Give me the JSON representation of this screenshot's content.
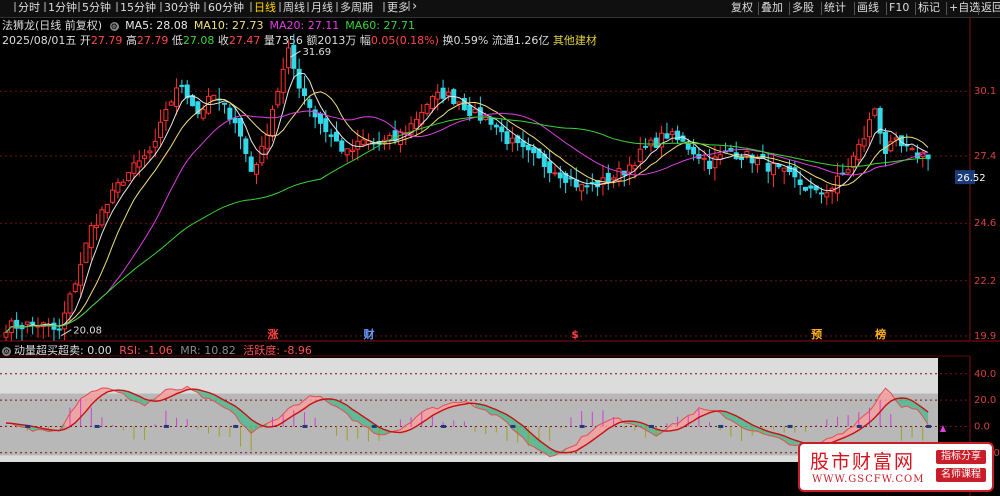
{
  "timeframe_tabs": [
    "分时",
    "1分钟",
    "5分钟",
    "15分钟",
    "30分钟",
    "60分钟",
    "日线",
    "周线",
    "月线",
    "多周期",
    "更多"
  ],
  "active_tab": "日线",
  "more_chevron": "chevron-right-icon",
  "right_buttons": [
    "复权",
    "叠加",
    "多股",
    "统计",
    "画线",
    "F10",
    "标记",
    "+自选",
    "返回"
  ],
  "stock": {
    "name": "法狮龙",
    "mode": "(日线 前复权)",
    "ma": [
      {
        "label": "MA5: 28.08",
        "color": "#e8e8e8"
      },
      {
        "label": "MA10: 27.73",
        "color": "#f0e07a"
      },
      {
        "label": "MA20: 27.11",
        "color": "#e040e0"
      },
      {
        "label": "MA60: 27.71",
        "color": "#3ad43a"
      }
    ]
  },
  "ohlc": {
    "date": "2025/08/01",
    "weekday": "五",
    "open_label": "开",
    "open": "27.79",
    "high_label": "高",
    "high": "27.79",
    "low_label": "低",
    "low": "27.08",
    "close_label": "收",
    "close": "27.47",
    "vol_label": "量",
    "vol": "7356",
    "amt_label": "额",
    "amt": "2013万",
    "chg_label": "幅",
    "chg": "0.05(0.18%)",
    "turn_label": "换",
    "turn": "0.59%",
    "float_label": "流通",
    "float": "1.26亿",
    "industry": "其他建材"
  },
  "indicator": {
    "name": "动量超买超卖",
    "value": ": 0.00",
    "rsi": "RSI: -1.06",
    "mr": "MR: 10.82",
    "act_label": "活跃度",
    "act_value": ": -8.96"
  },
  "markers": [
    {
      "text": "涨",
      "idx": 50,
      "color": "#ff4040"
    },
    {
      "text": "财",
      "idx": 68,
      "color": "#6a9cff"
    },
    {
      "text": "$",
      "idx": 107,
      "color": "#ff4040"
    },
    {
      "text": "预",
      "idx": 152,
      "color": "#ffb020"
    },
    {
      "text": "榜",
      "idx": 164,
      "color": "#ffb020"
    }
  ],
  "watermark": {
    "title": "股市财富网",
    "url": "WWW.GSCFW.COM",
    "tag1": "指标分享",
    "tag2": "名师课程"
  },
  "chart_data": [
    {
      "type": "candlestick",
      "price_axis_labels": [
        "30.1",
        "27.4",
        "26.52",
        "24.6",
        "22.2",
        "19.9"
      ],
      "ylim": [
        19.9,
        31.9
      ],
      "price_ticks": [
        30.1,
        27.4,
        24.6,
        22.2,
        19.9
      ],
      "current_price": 26.52,
      "annotations": [
        {
          "text": "31.69",
          "value": 31.69,
          "idx": 53
        },
        {
          "text": "20.08",
          "value": 20.08,
          "idx": 10
        }
      ],
      "n": 174,
      "ohlc_path": [
        [
          0,
          20.3
        ],
        [
          6,
          20.4
        ],
        [
          10,
          20.08
        ],
        [
          13,
          22.2
        ],
        [
          16,
          24.4
        ],
        [
          19,
          25.4
        ],
        [
          22,
          26.5
        ],
        [
          25,
          27.1
        ],
        [
          28,
          27.8
        ],
        [
          30,
          29.4
        ],
        [
          33,
          30.4
        ],
        [
          36,
          29.2
        ],
        [
          39,
          29.9
        ],
        [
          43,
          28.9
        ],
        [
          46,
          26.8
        ],
        [
          48,
          27.6
        ],
        [
          50,
          29.4
        ],
        [
          53,
          31.69
        ],
        [
          55,
          30.4
        ],
        [
          58,
          29.1
        ],
        [
          61,
          28.2
        ],
        [
          64,
          27.5
        ],
        [
          67,
          28.0
        ],
        [
          70,
          27.9
        ],
        [
          73,
          28.1
        ],
        [
          76,
          28.7
        ],
        [
          79,
          29.6
        ],
        [
          82,
          30.0
        ],
        [
          85,
          29.7
        ],
        [
          88,
          29.1
        ],
        [
          91,
          28.9
        ],
        [
          94,
          28.1
        ],
        [
          97,
          27.6
        ],
        [
          100,
          27.2
        ],
        [
          104,
          26.7
        ],
        [
          108,
          26.1
        ],
        [
          112,
          26.3
        ],
        [
          116,
          26.8
        ],
        [
          120,
          27.7
        ],
        [
          124,
          28.3
        ],
        [
          128,
          27.8
        ],
        [
          132,
          27.1
        ],
        [
          136,
          27.6
        ],
        [
          140,
          27.3
        ],
        [
          144,
          26.9
        ],
        [
          148,
          26.4
        ],
        [
          152,
          25.8
        ],
        [
          155,
          26.1
        ],
        [
          158,
          26.9
        ],
        [
          161,
          28.2
        ],
        [
          163,
          29.4
        ],
        [
          165,
          27.6
        ],
        [
          167,
          27.9
        ],
        [
          170,
          27.5
        ],
        [
          173,
          27.47
        ]
      ],
      "ma_end_values": {
        "MA5": 28.08,
        "MA10": 27.73,
        "MA20": 27.11,
        "MA60": 27.71
      }
    },
    {
      "type": "line",
      "series": [
        {
          "name": "RSI",
          "values_end": -1.06
        },
        {
          "name": "MR",
          "values_end": 10.82
        },
        {
          "name": "活跃度",
          "values_end": -8.96
        }
      ],
      "y_axis_labels": [
        "40.0",
        "20.0",
        "0.0",
        "-20.0"
      ],
      "yticks": [
        40,
        20,
        0,
        -20
      ],
      "ylim": [
        -27,
        52
      ],
      "band_upper": 25,
      "band_lower": -22,
      "osc_path": [
        [
          0,
          2
        ],
        [
          5,
          -3
        ],
        [
          10,
          -2
        ],
        [
          14,
          22
        ],
        [
          18,
          30
        ],
        [
          22,
          24
        ],
        [
          26,
          16
        ],
        [
          30,
          27
        ],
        [
          34,
          29
        ],
        [
          38,
          20
        ],
        [
          42,
          12
        ],
        [
          46,
          -5
        ],
        [
          50,
          4
        ],
        [
          54,
          16
        ],
        [
          58,
          24
        ],
        [
          62,
          14
        ],
        [
          66,
          3
        ],
        [
          70,
          -6
        ],
        [
          74,
          -2
        ],
        [
          78,
          11
        ],
        [
          82,
          16
        ],
        [
          86,
          20
        ],
        [
          90,
          12
        ],
        [
          94,
          3
        ],
        [
          98,
          -13
        ],
        [
          102,
          -22
        ],
        [
          106,
          -16
        ],
        [
          110,
          -2
        ],
        [
          114,
          6
        ],
        [
          118,
          2
        ],
        [
          122,
          -6
        ],
        [
          126,
          3
        ],
        [
          130,
          13
        ],
        [
          134,
          10
        ],
        [
          138,
          0
        ],
        [
          142,
          -6
        ],
        [
          146,
          -11
        ],
        [
          150,
          -17
        ],
        [
          154,
          -10
        ],
        [
          158,
          -2
        ],
        [
          162,
          12
        ],
        [
          165,
          30
        ],
        [
          168,
          16
        ],
        [
          171,
          12
        ],
        [
          173,
          1
        ]
      ]
    }
  ]
}
